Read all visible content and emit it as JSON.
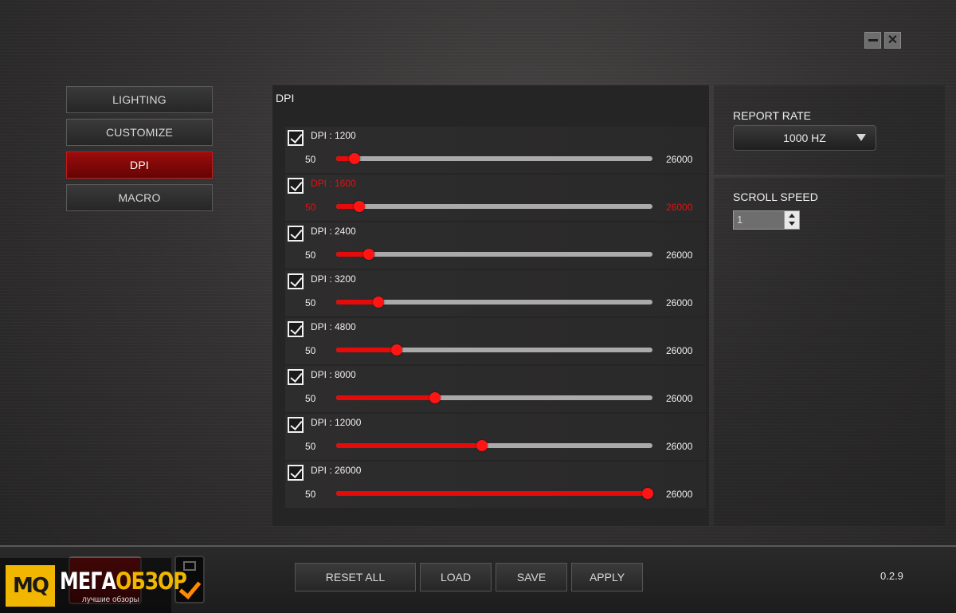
{
  "nav": [
    {
      "label": "LIGHTING",
      "active": false
    },
    {
      "label": "CUSTOMIZE",
      "active": false
    },
    {
      "label": "DPI",
      "active": true
    },
    {
      "label": "MACRO",
      "active": false
    }
  ],
  "dpi_panel": {
    "title": "DPI",
    "min_label": "50",
    "max_label": "26000",
    "range_min": 50,
    "range_max": 26000,
    "rows": [
      {
        "label": "DPI : 1200",
        "value": 1200,
        "checked": true,
        "highlighted": false
      },
      {
        "label": "DPI : 1600",
        "value": 1600,
        "checked": true,
        "highlighted": true
      },
      {
        "label": "DPI : 2400",
        "value": 2400,
        "checked": true,
        "highlighted": false
      },
      {
        "label": "DPI : 3200",
        "value": 3200,
        "checked": true,
        "highlighted": false
      },
      {
        "label": "DPI : 4800",
        "value": 4800,
        "checked": true,
        "highlighted": false
      },
      {
        "label": "DPI : 8000",
        "value": 8000,
        "checked": true,
        "highlighted": false
      },
      {
        "label": "DPI : 12000",
        "value": 12000,
        "checked": true,
        "highlighted": false
      },
      {
        "label": "DPI : 26000",
        "value": 26000,
        "checked": true,
        "highlighted": false
      }
    ]
  },
  "report_rate": {
    "label": "REPORT RATE",
    "value": "1000 HZ"
  },
  "scroll_speed": {
    "label": "SCROLL SPEED",
    "value": "1"
  },
  "actions": {
    "reset": "RESET ALL",
    "load": "LOAD",
    "save": "SAVE",
    "apply": "APPLY"
  },
  "version": "0.2.9",
  "window": {
    "close_glyph": "✕"
  },
  "watermark": {
    "badge": "MQ",
    "name_white": "МЕГА",
    "name_accent": "ОБЗОР",
    "tagline": "лучшие обзоры"
  },
  "colors": {
    "accent": "#e50b0b",
    "active_nav": "#8a0a0a",
    "brand_yellow": "#f1b700"
  }
}
